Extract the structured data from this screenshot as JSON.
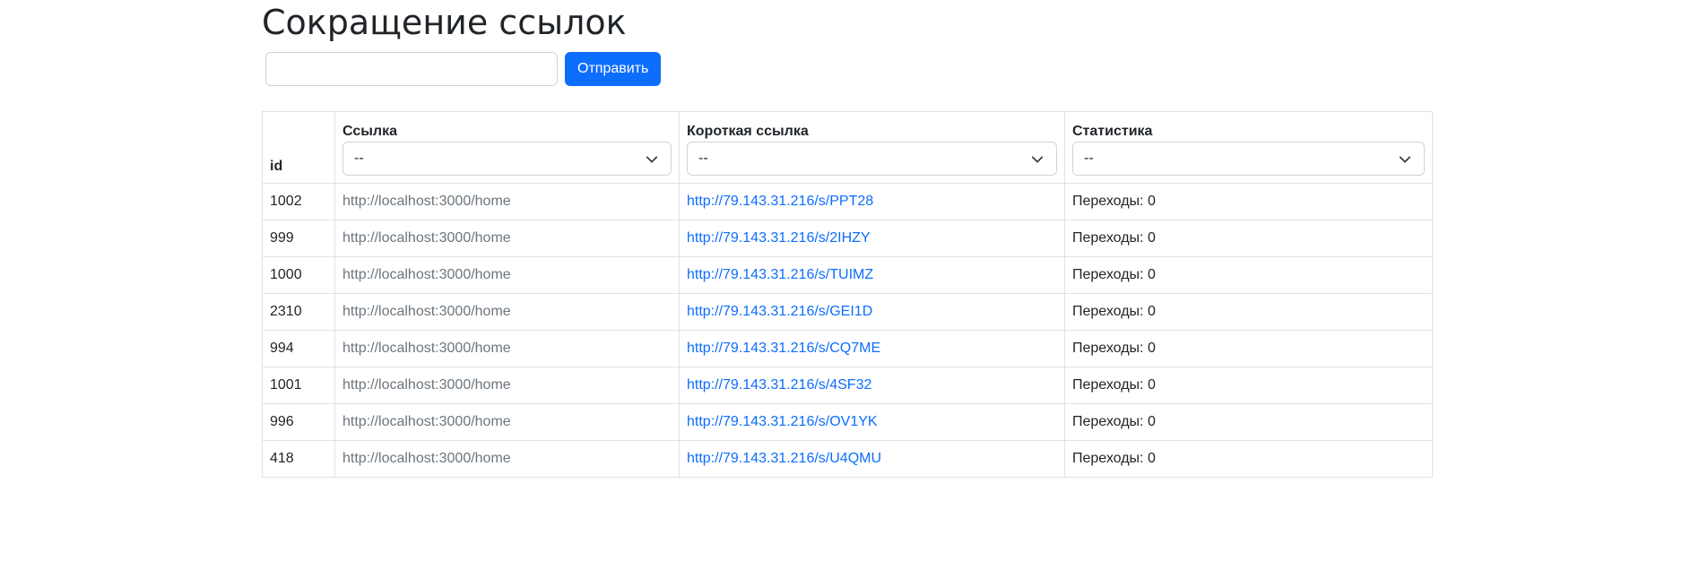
{
  "page": {
    "title": "Сокращение ссылок"
  },
  "form": {
    "input_value": "",
    "input_placeholder": "",
    "submit_label": "Отправить"
  },
  "table": {
    "headers": {
      "id": "id",
      "url": "Ссылка",
      "short": "Короткая ссылка",
      "stats": "Статистика"
    },
    "filters": {
      "url": "--",
      "short": "--",
      "stats": "--"
    },
    "icons": {
      "filter_dropdown": "chevron-down-icon"
    },
    "rows": [
      {
        "id": "1002",
        "url": "http://localhost:3000/home",
        "short": "http://79.143.31.216/s/PPT28",
        "stats": "Переходы: 0"
      },
      {
        "id": "999",
        "url": "http://localhost:3000/home",
        "short": "http://79.143.31.216/s/2IHZY",
        "stats": "Переходы: 0"
      },
      {
        "id": "1000",
        "url": "http://localhost:3000/home",
        "short": "http://79.143.31.216/s/TUIMZ",
        "stats": "Переходы: 0"
      },
      {
        "id": "2310",
        "url": "http://localhost:3000/home",
        "short": "http://79.143.31.216/s/GEI1D",
        "stats": "Переходы: 0"
      },
      {
        "id": "994",
        "url": "http://localhost:3000/home",
        "short": "http://79.143.31.216/s/CQ7ME",
        "stats": "Переходы: 0"
      },
      {
        "id": "1001",
        "url": "http://localhost:3000/home",
        "short": "http://79.143.31.216/s/4SF32",
        "stats": "Переходы: 0"
      },
      {
        "id": "996",
        "url": "http://localhost:3000/home",
        "short": "http://79.143.31.216/s/OV1YK",
        "stats": "Переходы: 0"
      },
      {
        "id": "418",
        "url": "http://localhost:3000/home",
        "short": "http://79.143.31.216/s/U4QMU",
        "stats": "Переходы: 0"
      }
    ]
  },
  "colors": {
    "primary": "#0d6efd",
    "text": "#212529",
    "muted": "#6c757d",
    "border": "#dee2e6"
  }
}
